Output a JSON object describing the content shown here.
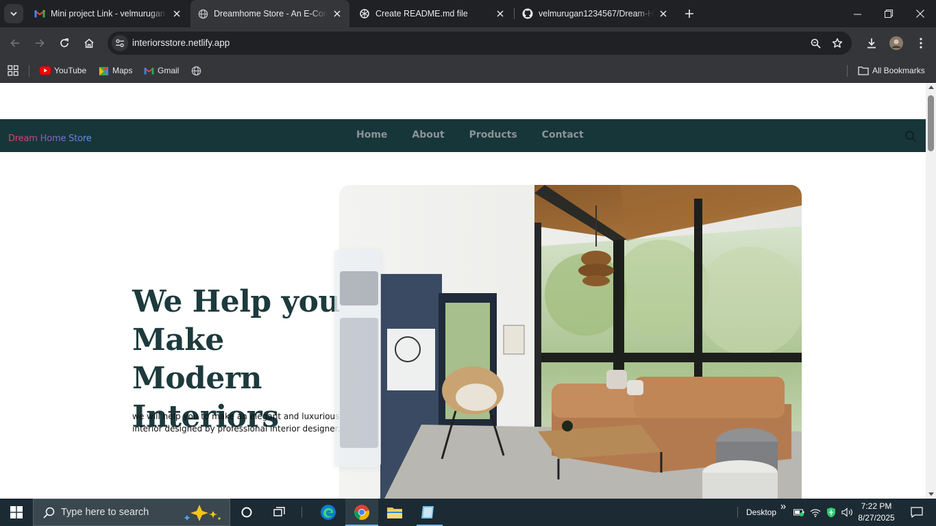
{
  "browser": {
    "tabs": [
      {
        "title": "Mini project Link - velmurugan",
        "icon": "gmail-icon"
      },
      {
        "title": "Dreamhome Store - An E-Comm",
        "icon": "globe-icon"
      },
      {
        "title": "Create README.md file",
        "icon": "chatgpt-icon"
      },
      {
        "title": "velmurugan1234567/Dream-Ho",
        "icon": "github-icon"
      }
    ],
    "active_tab": 1,
    "url": "interiorsstore.netlify.app",
    "bookmarks": [
      {
        "label": "YouTube",
        "icon": "youtube-icon"
      },
      {
        "label": "Maps",
        "icon": "maps-icon"
      },
      {
        "label": "Gmail",
        "icon": "gmail-icon"
      }
    ],
    "all_bookmarks_label": "All Bookmarks"
  },
  "site": {
    "logo": "Dream Home Store",
    "nav": [
      "Home",
      "About",
      "Products",
      "Contact"
    ],
    "hero": {
      "title_lines": [
        "We Help you",
        "Make Modern",
        "Interiors"
      ],
      "subtitle_lines": [
        "we will help you to make an elegant and luxurious interiors",
        "interior designed by professional interior designer."
      ]
    },
    "colors": {
      "nav_bg": "#17363a",
      "title": "#1d3a3d",
      "nav_link": "#8c9496"
    }
  },
  "taskbar": {
    "search_placeholder": "Type here to search",
    "desktop_label": "Desktop",
    "time": "7:22 PM",
    "date": "8/27/2025"
  }
}
